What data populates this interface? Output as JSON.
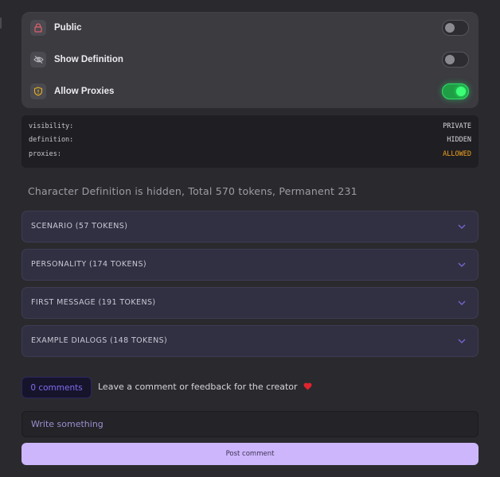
{
  "settings": {
    "rows": [
      {
        "label": "Public",
        "icon": "lock-icon",
        "enabled": false
      },
      {
        "label": "Show Definition",
        "icon": "eye-off-icon",
        "enabled": false
      },
      {
        "label": "Allow Proxies",
        "icon": "shield-icon",
        "enabled": true
      }
    ]
  },
  "status": {
    "lines": [
      {
        "key": "visibility:",
        "value": "PRIVATE"
      },
      {
        "key": "definition:",
        "value": "HIDDEN"
      },
      {
        "key": "proxies:",
        "value": "ALLOWED"
      }
    ],
    "allowed_color": "#f0a020"
  },
  "summary": "Character Definition is hidden, Total 570 tokens, Permanent 231",
  "sections": [
    {
      "label": "SCENARIO (57 TOKENS)"
    },
    {
      "label": "PERSONALITY (174 TOKENS)"
    },
    {
      "label": "FIRST MESSAGE (191 TOKENS)"
    },
    {
      "label": "EXAMPLE DIALOGS (148 TOKENS)"
    }
  ],
  "comments": {
    "count_label": "0 comments",
    "prompt": "Leave a comment or feedback for the creator",
    "prompt_icon": "heart-icon",
    "input_placeholder": "Write something",
    "post_label": "Post comment"
  },
  "colors": {
    "toggle_on": "#2fe06a",
    "accent": "#7d6cf2",
    "post_button": "#cdb6fb"
  }
}
